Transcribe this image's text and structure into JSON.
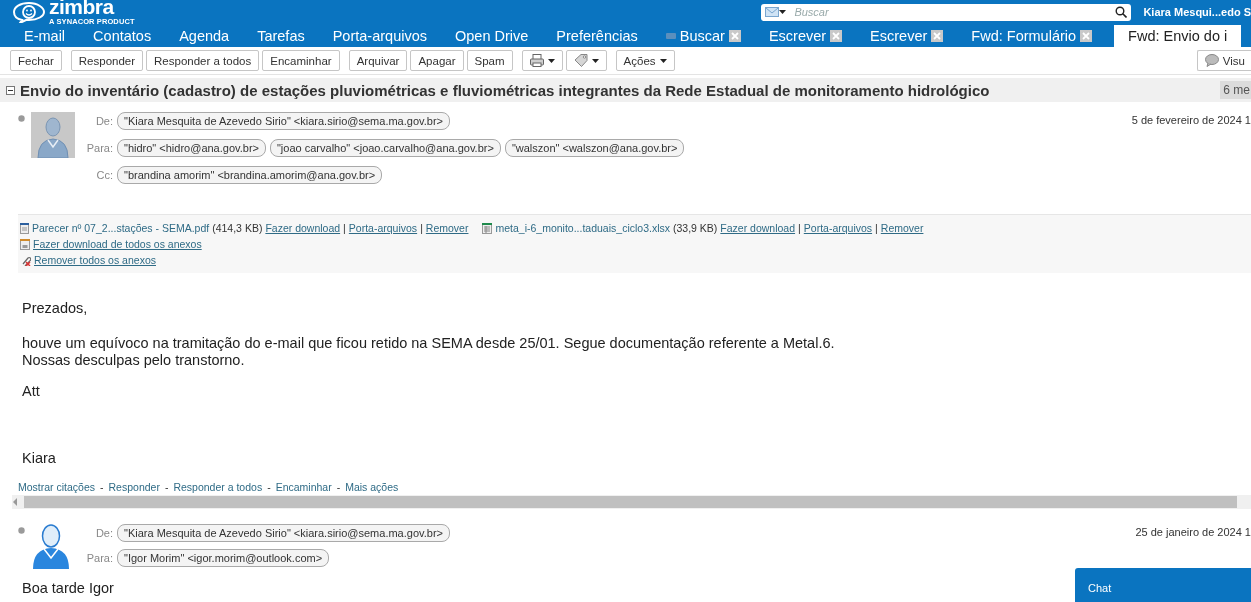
{
  "header": {
    "logo": "zimbra",
    "logo_tagline": "A SYNACOR PRODUCT",
    "search": {
      "placeholder": "Buscar"
    },
    "user": "Kiara Mesqui...edo S"
  },
  "tabs": [
    {
      "label": "E-mail",
      "selected": false,
      "closable": false
    },
    {
      "label": "Contatos",
      "selected": false,
      "closable": false
    },
    {
      "label": "Agenda",
      "selected": false,
      "closable": false
    },
    {
      "label": "Tarefas",
      "selected": false,
      "closable": false
    },
    {
      "label": "Porta-arquivos",
      "selected": false,
      "closable": false
    },
    {
      "label": "Open Drive",
      "selected": false,
      "closable": false
    },
    {
      "label": "Preferências",
      "selected": false,
      "closable": false
    },
    {
      "label": "Buscar",
      "selected": false,
      "closable": true,
      "kind": "search"
    },
    {
      "label": "Escrever",
      "selected": false,
      "closable": true
    },
    {
      "label": "Escrever",
      "selected": false,
      "closable": true
    },
    {
      "label": "Fwd: Formulário",
      "selected": false,
      "closable": true
    },
    {
      "label": "Fwd: Envio do i",
      "selected": true,
      "closable": false
    }
  ],
  "toolbar": {
    "buttons": [
      {
        "kind": "text",
        "label": "Fechar"
      },
      {
        "kind": "text",
        "label": "Responder",
        "separated_before": true
      },
      {
        "kind": "text",
        "label": "Responder a todos"
      },
      {
        "kind": "text",
        "label": "Encaminhar"
      },
      {
        "kind": "text",
        "label": "Arquivar",
        "separated_before": true
      },
      {
        "kind": "text",
        "label": "Apagar"
      },
      {
        "kind": "text",
        "label": "Spam"
      },
      {
        "kind": "print-menu",
        "separated_before": true
      },
      {
        "kind": "tag-menu"
      },
      {
        "kind": "menu",
        "label": "Ações",
        "separated_before": true
      }
    ],
    "view_button": "Visu"
  },
  "conversation": {
    "subject": "Envio do inventário (cadastro) de estações pluviométricas e fluviométricas integrantes da Rede Estadual de monitoramento hidrológico",
    "count": "6 me"
  },
  "messages": [
    {
      "avatar": {
        "kind": "boxed"
      },
      "date": "5 de fevereiro de 2024 1",
      "recipients": [
        {
          "label": "De:",
          "addresses": [
            "\"Kiara Mesquita de Azevedo Sirio\" <kiara.sirio@sema.ma.gov.br>"
          ]
        },
        {
          "label": "Para:",
          "addresses": [
            "\"hidro\" <hidro@ana.gov.br>",
            "\"joao carvalho\" <joao.carvalho@ana.gov.br>",
            "\"walszon\" <walszon@ana.gov.br>"
          ]
        },
        {
          "label": "Cc:",
          "addresses": [
            "\"brandina amorim\" <brandina.amorim@ana.gov.br>"
          ]
        }
      ],
      "attachments": [
        {
          "kind": "pdf",
          "name": "Parecer nº 07_2...stações - SEMA.pdf",
          "size": "(414,3 KB)",
          "links": [
            "Fazer download",
            "Porta-arquivos",
            "Remover"
          ]
        },
        {
          "kind": "spreadsheet",
          "name": "meta_i-6_monito...taduais_ciclo3.xlsx",
          "size": "(33,9 KB)",
          "links": [
            "Fazer download",
            "Porta-arquivos",
            "Remover"
          ]
        }
      ],
      "link_separator": "|",
      "download_all": "Fazer download de todos os anexos",
      "remove_all": "Remover todos os anexos",
      "body": [
        [
          "Prezados,"
        ],
        [
          "houve um equívoco na tramitação do e-mail que ficou retido na SEMA desde 25/01. Segue documentação referente a Metal.6.",
          "Nossas desculpas pelo transtorno."
        ],
        [
          "Att"
        ],
        [
          "Kiara"
        ]
      ],
      "actions": [
        "Mostrar citações",
        "Responder",
        "Responder a todos",
        "Encaminhar",
        "Mais ações"
      ],
      "action_separator": "-"
    },
    {
      "avatar": {
        "kind": "plain"
      },
      "date": "25 de janeiro de 2024 1",
      "recipients": [
        {
          "label": "De:",
          "addresses": [
            "\"Kiara Mesquita de Azevedo Sirio\" <kiara.sirio@sema.ma.gov.br>"
          ]
        },
        {
          "label": "Para:",
          "addresses": [
            "\"Igor Morim\" <igor.morim@outlook.com>"
          ]
        }
      ],
      "body": [
        [
          "Boa tarde Igor"
        ]
      ]
    }
  ],
  "chat": {
    "label": "Chat"
  }
}
